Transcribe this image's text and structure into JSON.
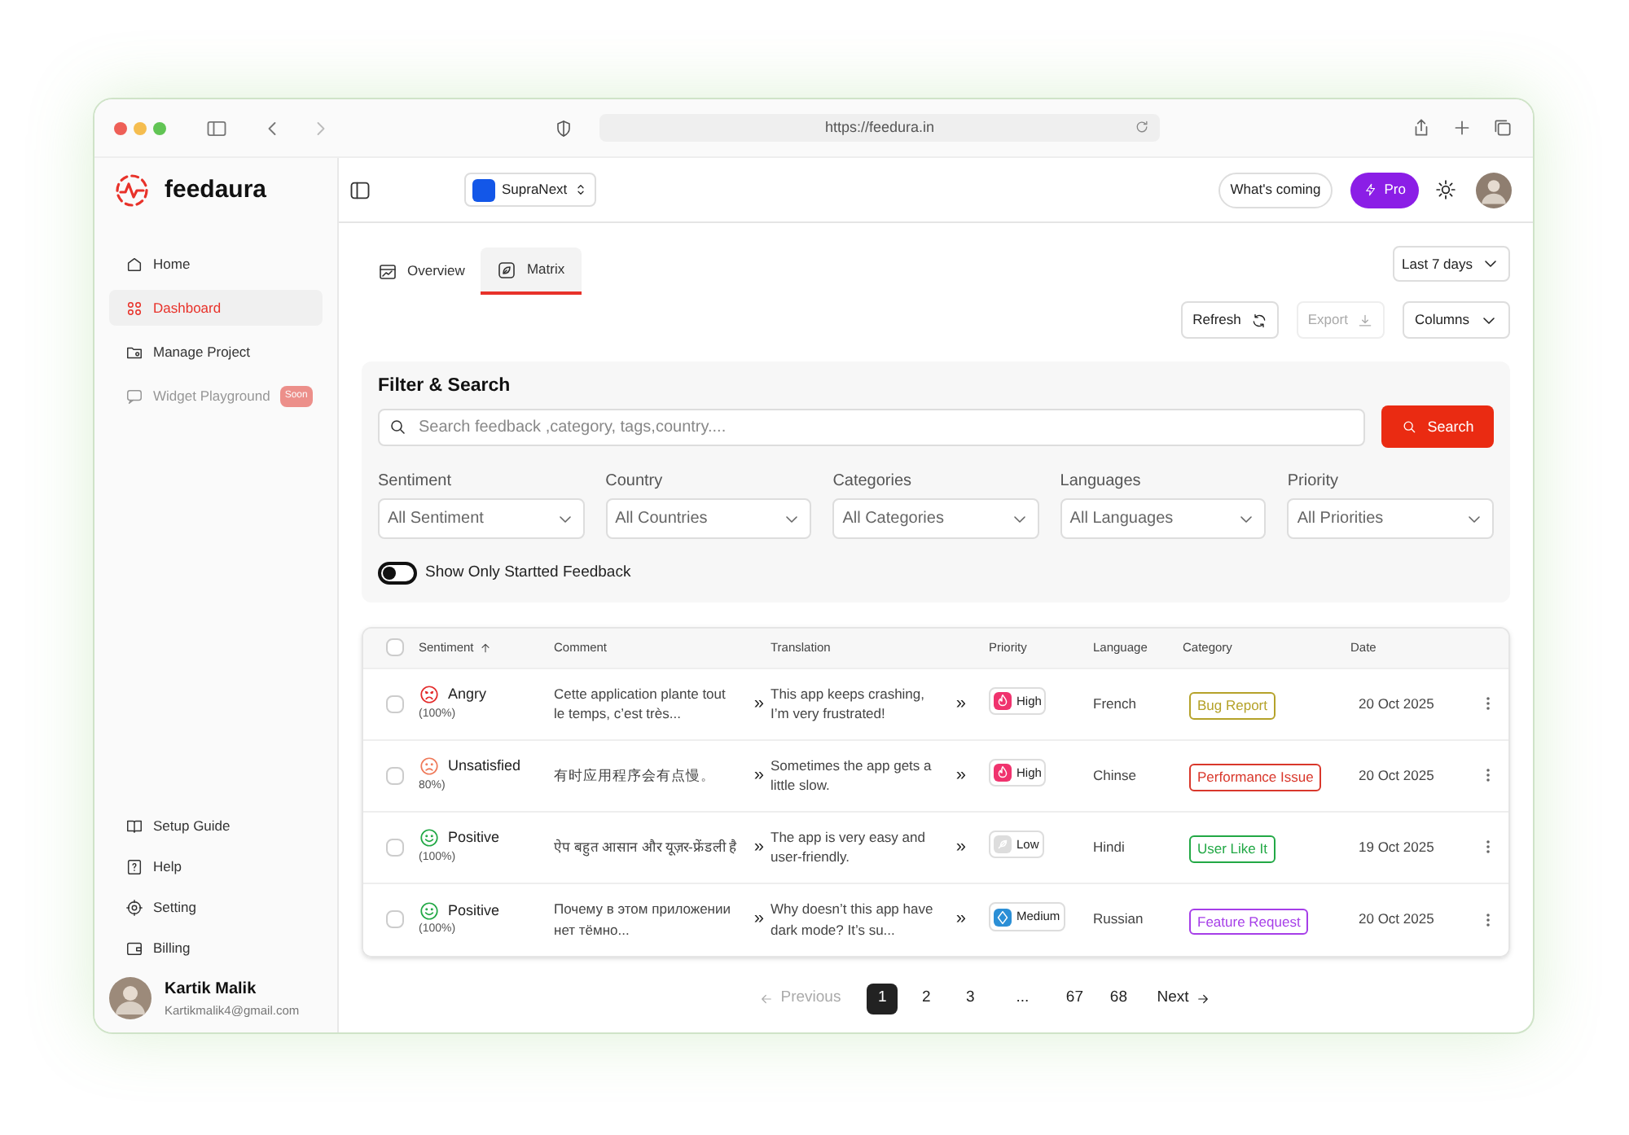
{
  "browser": {
    "url": "https://feedura.in"
  },
  "sidebar": {
    "brand": "feedaura",
    "items": [
      {
        "label": "Home",
        "selected": false,
        "disabled": false
      },
      {
        "label": "Dashboard",
        "selected": true,
        "disabled": false
      },
      {
        "label": "Manage Project",
        "selected": false,
        "disabled": false
      },
      {
        "label": "Widget Playground",
        "selected": false,
        "disabled": true,
        "badge": "Soon"
      }
    ],
    "bottom_items": [
      {
        "label": "Setup Guide"
      },
      {
        "label": "Help"
      },
      {
        "label": "Setting"
      },
      {
        "label": "Billing"
      }
    ],
    "user": {
      "name": "Kartik Malik",
      "email": "Kartikmalik4@gmail.com"
    }
  },
  "header": {
    "project": "SupraNext",
    "whats_coming": "What's coming",
    "pro": "Pro"
  },
  "tabs": [
    {
      "label": "Overview",
      "selected": false
    },
    {
      "label": "Matrix",
      "selected": true
    }
  ],
  "range": "Last 7 days",
  "actions": [
    {
      "label": "Refresh",
      "kind": "refresh",
      "disabled": false
    },
    {
      "label": "Export",
      "kind": "export",
      "disabled": true
    },
    {
      "label": "Columns",
      "kind": "dropdown",
      "disabled": false
    }
  ],
  "filter": {
    "title": "Filter & Search",
    "placeholder": "Search feedback ,category, tags,country....",
    "search_button": "Search",
    "selects": [
      {
        "label": "Sentiment",
        "value": "All Sentiment"
      },
      {
        "label": "Country",
        "value": "All Countries"
      },
      {
        "label": "Categories",
        "value": "All Categories"
      },
      {
        "label": "Languages",
        "value": "All Languages"
      },
      {
        "label": "Priority",
        "value": "All Priorities"
      }
    ],
    "toggle": {
      "label": "Show Only Startted Feedback",
      "on": false
    }
  },
  "table": {
    "all_checked": false,
    "columns": [
      "Sentiment",
      "Comment",
      "Translation",
      "Priority",
      "Language",
      "Category",
      "Date"
    ],
    "rows": [
      {
        "checked": false,
        "sentiment": {
          "label": "Angry",
          "kind": "angry",
          "score": "(100%)"
        },
        "comment": "Cette application plante tout le temps, c’est très...",
        "comment_more": "»",
        "translation": "This app keeps crashing, I’m very frustrated!",
        "translation_more": "»",
        "priority": {
          "label": "High",
          "kind": "high"
        },
        "language": "French",
        "category": "Bug Report",
        "color": "#b5a22a",
        "date": "20 Oct 2025"
      },
      {
        "checked": false,
        "sentiment": {
          "label": "Unsatisfied",
          "kind": "unsatisfied",
          "score": "80%)"
        },
        "comment": "有时应用程序会有点慢。",
        "comment_more": "»",
        "translation": "Sometimes the app gets a little slow.",
        "translation_more": "»",
        "priority": {
          "label": "High",
          "kind": "high"
        },
        "language": "Chinse",
        "category": "Performance Issue",
        "color": "#d9372b",
        "date": "20 Oct 2025"
      },
      {
        "checked": false,
        "sentiment": {
          "label": "Positive",
          "kind": "positive",
          "score": "(100%)"
        },
        "comment": "ऐप बहुत आसान और यूज़र-फ्रेंडली है",
        "comment_more": "»",
        "translation": "The app is very easy and user-friendly.",
        "translation_more": "»",
        "priority": {
          "label": "Low",
          "kind": "low"
        },
        "language": "Hindi",
        "category": "User Like It",
        "color": "#22a845",
        "date": "19 Oct 2025"
      },
      {
        "checked": false,
        "sentiment": {
          "label": "Positive",
          "kind": "positive",
          "score": "(100%)"
        },
        "comment": "Почему в этом приложении нет тёмно...",
        "comment_more": "»",
        "translation": "Why doesn’t this app have dark mode? It’s su...",
        "translation_more": "»",
        "priority": {
          "label": "Medium",
          "kind": "medium"
        },
        "language": "Russian",
        "category": "Feature Request",
        "color": "#a63ee8",
        "date": "20 Oct 2025"
      }
    ]
  },
  "pagination": {
    "previous": "Previous",
    "next": "Next",
    "pages": [
      {
        "label": "1",
        "selected": true
      },
      {
        "label": "2",
        "selected": false
      },
      {
        "label": "3",
        "selected": false
      },
      {
        "label": "...",
        "selected": false
      },
      {
        "label": "67",
        "selected": false
      },
      {
        "label": "68",
        "selected": false
      }
    ]
  }
}
